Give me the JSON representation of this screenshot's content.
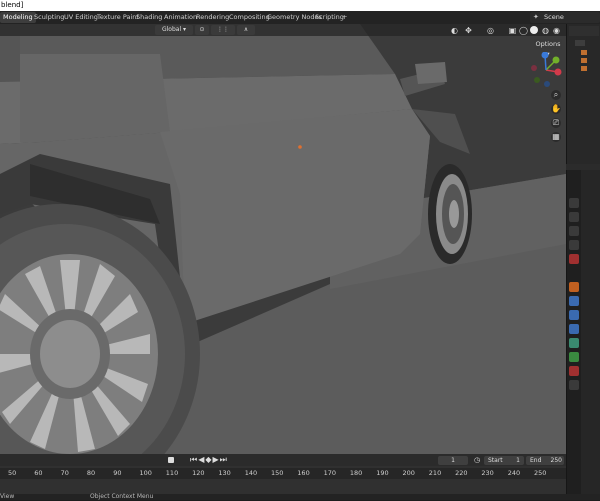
{
  "window": {
    "title": "blend]"
  },
  "workspace_tabs": [
    {
      "label": "Modeling"
    },
    {
      "label": "Sculpting"
    },
    {
      "label": "UV Editing"
    },
    {
      "label": "Texture Paint"
    },
    {
      "label": "Shading"
    },
    {
      "label": "Animation"
    },
    {
      "label": "Rendering"
    },
    {
      "label": "Compositing"
    },
    {
      "label": "Geometry Nodes"
    },
    {
      "label": "Scripting"
    },
    {
      "label": "+"
    }
  ],
  "scene": {
    "label": "Scene"
  },
  "viewport": {
    "transform_orientation": "Global",
    "options_label": "Options"
  },
  "gizmo": {
    "x_label": "X",
    "y_label": "Y",
    "z_label": "Z",
    "colors": {
      "x": "#d23a4a",
      "y": "#72b02a",
      "z": "#3a7ad9"
    }
  },
  "timeline": {
    "ticks": [
      "50",
      "60",
      "70",
      "80",
      "90",
      "100",
      "110",
      "120",
      "130",
      "140",
      "150",
      "160",
      "170",
      "180",
      "190",
      "200",
      "210",
      "220",
      "230",
      "240",
      "250"
    ],
    "current_frame": "1",
    "start_label": "Start",
    "start_value": "1",
    "end_label": "End",
    "end_value": "250"
  },
  "statusbar": {
    "left_text": "View",
    "context_text": "Object Context Menu"
  }
}
